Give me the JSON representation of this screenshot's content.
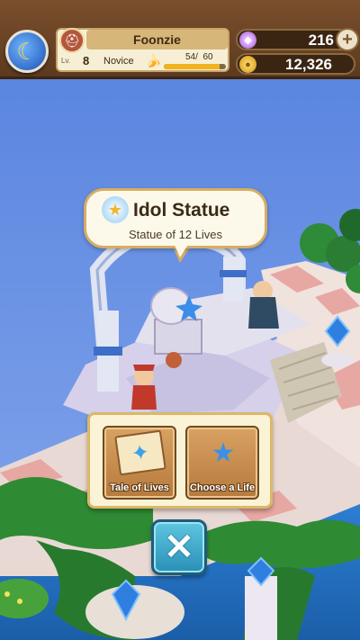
{
  "header": {
    "player_name": "Foonzie",
    "level_label": "Lv.",
    "level": "8",
    "rank": "Novice",
    "exp_text": "54/  60",
    "exp_progress": 0.9,
    "gems": "216",
    "coins": "12,326"
  },
  "bubble": {
    "title": "Idol Statue",
    "subtitle": "Statue of 12 Lives"
  },
  "actions": [
    {
      "label": "Tale of Lives",
      "icon": "open-book-icon"
    },
    {
      "label": "Choose a Life",
      "icon": "planet-statue-icon"
    }
  ],
  "icons": {
    "menu": "moon-key-icon",
    "profile": "helmet-icon",
    "exp": "banana-icon",
    "gem": "gem-icon",
    "coin": "coin-icon",
    "close": "close-icon"
  },
  "colors": {
    "topbar": "#6b4424",
    "panel": "#fbf3d6",
    "close_button": "#3aa6cb",
    "exp_fill": "#f2b21c"
  }
}
